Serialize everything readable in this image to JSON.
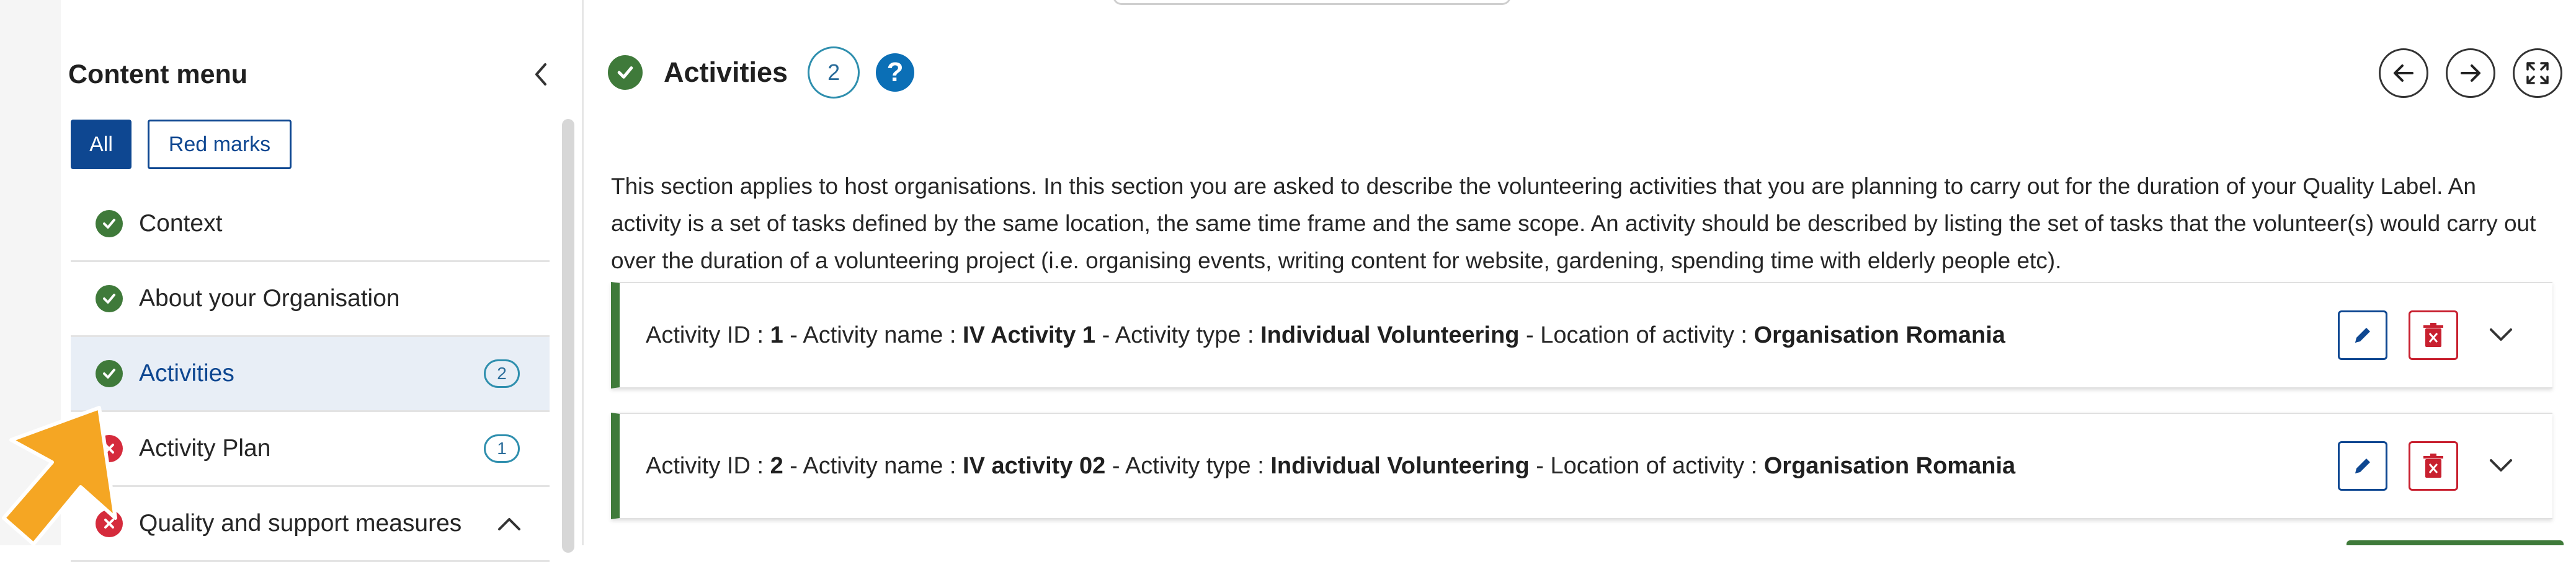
{
  "sidebar": {
    "title": "Content menu",
    "filters": {
      "all": "All",
      "red_marks": "Red marks"
    },
    "items": [
      {
        "label": "Context",
        "status": "ok"
      },
      {
        "label": "About your Organisation",
        "status": "ok"
      },
      {
        "label": "Activities",
        "status": "ok",
        "count": "2",
        "active": true
      },
      {
        "label": "Activity Plan",
        "status": "error",
        "count": "1"
      },
      {
        "label": "Quality and support measures",
        "status": "error",
        "expanded": true
      }
    ]
  },
  "main": {
    "title": "Activities",
    "count": "2",
    "help": "?",
    "intro": "This section applies to host organisations. In this section you are asked to describe the volunteering activities that you are planning to carry out for the duration of your Quality Label. An activity is a set of tasks defined by the same location, the same time frame and the same scope. An activity should be described by listing the set of tasks that the volunteer(s) would carry out over the duration of a volunteering project (i.e. organising events, writing content for website, gardening, spending time with elderly people etc).",
    "labels": {
      "id": "Activity ID : ",
      "name": " - Activity name : ",
      "type": " - Activity type : ",
      "location": " - Location of activity : "
    },
    "activities": [
      {
        "id": "1",
        "name": "IV Activity 1",
        "type": "Individual Volunteering",
        "location": "Organisation Romania"
      },
      {
        "id": "2",
        "name": "IV activity 02",
        "type": "Individual Volunteering",
        "location": "Organisation Romania"
      }
    ]
  },
  "colors": {
    "primary": "#0e4791",
    "success": "#3f7a3a",
    "danger": "#d52b3c",
    "info": "#2f8fae",
    "pointer": "#f5a623"
  }
}
